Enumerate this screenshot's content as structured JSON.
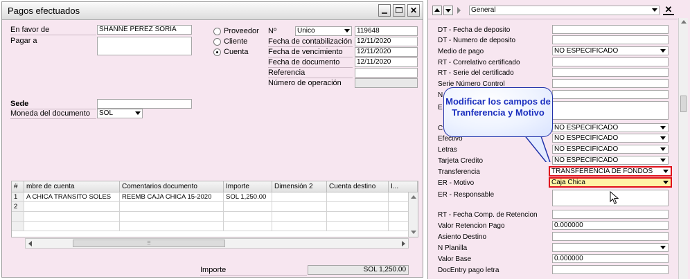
{
  "window": {
    "title": "Pagos efectuados"
  },
  "left": {
    "en_favor_de_label": "En favor de",
    "en_favor_de_value": "SHANNE PEREZ SORIA",
    "pagar_a_label": "Pagar a",
    "sede_label": "Sede",
    "moneda_label": "Moneda del documento",
    "moneda_value": "SOL",
    "radio_proveedor": "Proveedor",
    "radio_cliente": "Cliente",
    "radio_cuenta": "Cuenta",
    "no_label": "Nº",
    "no_series": "Unico",
    "no_value": "119648",
    "fecha_contab_label": "Fecha de contabilización",
    "fecha_contab_value": "12/11/2020",
    "fecha_venc_label": "Fecha de vencimiento",
    "fecha_venc_value": "12/11/2020",
    "fecha_doc_label": "Fecha de documento",
    "fecha_doc_value": "12/11/2020",
    "referencia_label": "Referencia",
    "num_operacion_label": "Número de operación",
    "importe_label": "Importe",
    "importe_value": "SOL 1,250.00"
  },
  "grid": {
    "headers": [
      "#",
      "mbre de cuenta",
      "Comentarios documento",
      "Importe",
      "Dimensión 2",
      "Cuenta destino",
      "I..."
    ],
    "rows": [
      [
        "1",
        "A CHICA TRANSITO SOLES",
        "REEMB CAJA CHICA 15-2020",
        "SOL 1,250.00",
        "",
        "",
        ""
      ],
      [
        "2",
        "",
        "",
        "",
        "",
        "",
        ""
      ]
    ],
    "scroll_grip": "⠿"
  },
  "side": {
    "dropdown_value": "General",
    "close_glyph": "✕",
    "fields": [
      {
        "label": "DT - Fecha de deposito",
        "value": ""
      },
      {
        "label": "DT - Numero de deposito",
        "value": ""
      },
      {
        "label": "Medio de pago",
        "value": "NO ESPECIFICADO"
      },
      {
        "label": "RT - Correlativo certificado",
        "value": ""
      },
      {
        "label": "RT - Serie del certificado",
        "value": ""
      },
      {
        "label": "Serie Número Control",
        "value": ""
      },
      {
        "label": "N",
        "value": ""
      },
      {
        "label": "E",
        "value": ""
      },
      {
        "label": "C",
        "value": "NO ESPECIFICADO"
      },
      {
        "label": "Efectivo",
        "value": "NO ESPECIFICADO"
      },
      {
        "label": "Letras",
        "value": "NO ESPECIFICADO"
      },
      {
        "label": "Tarjeta Credito",
        "value": "NO ESPECIFICADO"
      },
      {
        "label": "Transferencia",
        "value": "TRANSFERENCIA DE FONDOS"
      },
      {
        "label": "ER - Motivo",
        "value": "Caja Chica"
      },
      {
        "label": "ER - Responsable",
        "value": ""
      },
      {
        "label": "RT - Fecha Comp. de Retencion",
        "value": ""
      },
      {
        "label": "Valor Retencion Pago",
        "value": "0.000000"
      },
      {
        "label": "Asiento Destino",
        "value": ""
      },
      {
        "label": "N Planilla",
        "value": ""
      },
      {
        "label": "Valor Base",
        "value": "0.000000"
      },
      {
        "label": "DocEntry pago letra",
        "value": ""
      }
    ],
    "callout": "Modificar los campos de Tranferencia y Motivo"
  },
  "colors": {
    "highlight_border": "#e0101a",
    "motivo_fill": "#fff3a6",
    "callout_text": "#1b2fbf"
  }
}
